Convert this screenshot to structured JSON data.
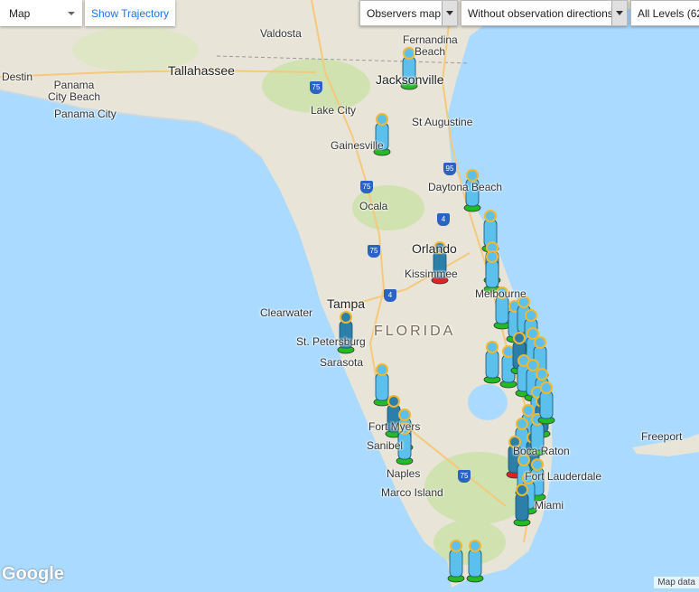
{
  "controls": {
    "map_type": "Map",
    "show_trajectory": "Show Trajectory",
    "observers_map": "Observers map",
    "directions": "Without observation directions",
    "levels": "All Levels (62"
  },
  "labels": {
    "cities": [
      "Destin",
      "Panama City Beach",
      "Panama City",
      "Tallahassee",
      "Valdosta",
      "Fernandina Beach",
      "Jacksonville",
      "Lake City",
      "St Augustine",
      "Gainesville",
      "Daytona Beach",
      "Ocala",
      "Orlando",
      "Kissimmee",
      "Melbourne",
      "Tampa",
      "Clearwater",
      "St. Petersburg",
      "Sarasota",
      "Fort Myers",
      "Sanibel",
      "Naples",
      "Marco Island",
      "Boca Raton",
      "Fort Lauderdale",
      "Miami",
      "Freeport"
    ],
    "state": "FLORIDA",
    "highways": [
      "75",
      "75",
      "75",
      "95",
      "4",
      "4",
      "75"
    ]
  },
  "attribution": {
    "logo": "Google",
    "data": "Map data"
  },
  "colors": {
    "water": "#aadaff",
    "land": "#e8e5d8",
    "park": "#c8dfa8",
    "observer": "#5bc0eb",
    "observer_dark": "#2c7fa8",
    "base_green": "#22bb22",
    "base_red": "#dd2222",
    "head": "#f0b830"
  }
}
